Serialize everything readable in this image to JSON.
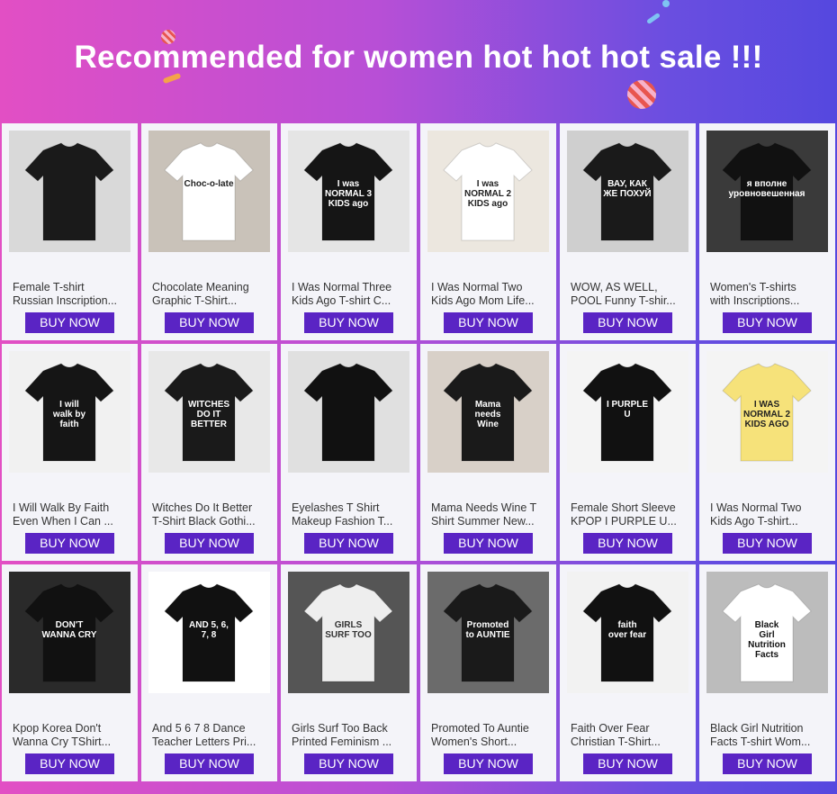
{
  "banner": {
    "title": "Recommended for women hot hot hot sale !!!"
  },
  "buy_label": "BUY NOW",
  "products": [
    {
      "l1": "Female T-shirt",
      "l2": "Russian Inscription...",
      "shirt": "#1a1a1a",
      "bg": "#d9d9d9",
      "text": "#ffffff",
      "print": "",
      "icon": "shirt-photo-icon"
    },
    {
      "l1": "Chocolate Meaning",
      "l2": "Graphic T-Shirt...",
      "shirt": "#ffffff",
      "bg": "#c9c2b9",
      "text": "#222222",
      "print": "Choc-o-late",
      "icon": "shirt-photo-icon"
    },
    {
      "l1": "I Was Normal Three",
      "l2": "Kids Ago T-shirt C...",
      "shirt": "#151515",
      "bg": "#e5e5e5",
      "text": "#ffffff",
      "print": "I was NORMAL 3 KIDS ago",
      "icon": "shirt-photo-icon"
    },
    {
      "l1": "I Was Normal Two",
      "l2": "Kids Ago Mom Life...",
      "shirt": "#ffffff",
      "bg": "#ece7df",
      "text": "#222222",
      "print": "I was NORMAL 2 KIDS ago",
      "icon": "shirt-photo-icon"
    },
    {
      "l1": "WOW, AS WELL,",
      "l2": "POOL Funny T-shir...",
      "shirt": "#1a1a1a",
      "bg": "#cfcfcf",
      "text": "#ffffff",
      "print": "ВАУ, КАК ЖЕ ПОХУЙ",
      "icon": "shirt-photo-icon"
    },
    {
      "l1": "Women's T-shirts",
      "l2": "with Inscriptions...",
      "shirt": "#111111",
      "bg": "#3a3a3a",
      "text": "#ffffff",
      "print": "я вполне уровновешенная",
      "icon": "shirt-photo-icon"
    },
    {
      "l1": "I Will Walk By Faith",
      "l2": "Even When I Can ...",
      "shirt": "#151515",
      "bg": "#f1f1f1",
      "text": "#ffffff",
      "print": "I will walk by faith",
      "icon": "shirt-photo-icon"
    },
    {
      "l1": "Witches Do It Better",
      "l2": "T-Shirt Black Gothi...",
      "shirt": "#1a1a1a",
      "bg": "#e8e8e8",
      "text": "#ffffff",
      "print": "WITCHES DO IT BETTER",
      "icon": "shirt-photo-icon"
    },
    {
      "l1": "Eyelashes T Shirt",
      "l2": "Makeup Fashion T...",
      "shirt": "#111111",
      "bg": "#e0e0e0",
      "text": "#ffffff",
      "print": "",
      "icon": "shirt-photo-icon"
    },
    {
      "l1": "Mama Needs Wine T",
      "l2": "Shirt Summer New...",
      "shirt": "#1a1a1a",
      "bg": "#d8d0c8",
      "text": "#ffffff",
      "print": "Mama needs Wine",
      "icon": "shirt-photo-icon"
    },
    {
      "l1": "Female Short Sleeve",
      "l2": "KPOP I PURPLE U...",
      "shirt": "#111111",
      "bg": "#f4f4f4",
      "text": "#ffffff",
      "print": "I PURPLE U",
      "icon": "shirt-photo-icon"
    },
    {
      "l1": "I Was Normal Two",
      "l2": "Kids Ago T-shirt...",
      "shirt": "#f6e27a",
      "bg": "#f4f4f4",
      "text": "#222222",
      "print": "I WAS NORMAL 2 KIDS AGO",
      "icon": "shirt-photo-icon"
    },
    {
      "l1": "Kpop Korea Don't",
      "l2": "Wanna Cry TShirt...",
      "shirt": "#111111",
      "bg": "#2a2a2a",
      "text": "#ffffff",
      "print": "DON'T WANNA CRY",
      "icon": "shirt-photo-icon"
    },
    {
      "l1": "And 5 6 7 8 Dance",
      "l2": "Teacher Letters Pri...",
      "shirt": "#111111",
      "bg": "#ffffff",
      "text": "#ffffff",
      "print": "AND 5, 6, 7, 8",
      "icon": "shirt-photo-icon"
    },
    {
      "l1": "Girls Surf Too Back",
      "l2": "Printed Feminism ...",
      "shirt": "#eeeeee",
      "bg": "#555555",
      "text": "#333333",
      "print": "GIRLS SURF TOO",
      "icon": "shirt-photo-icon"
    },
    {
      "l1": "Promoted To Auntie",
      "l2": "Women's Short...",
      "shirt": "#1a1a1a",
      "bg": "#6b6b6b",
      "text": "#ffffff",
      "print": "Promoted to AUNTIE",
      "icon": "shirt-photo-icon"
    },
    {
      "l1": "Faith Over Fear",
      "l2": "Christian T-Shirt...",
      "shirt": "#111111",
      "bg": "#f2f2f2",
      "text": "#ffffff",
      "print": "faith over fear",
      "icon": "shirt-photo-icon"
    },
    {
      "l1": "Black Girl Nutrition",
      "l2": "Facts T-shirt Wom...",
      "shirt": "#ffffff",
      "bg": "#bcbcbc",
      "text": "#111111",
      "print": "Black Girl Nutrition Facts",
      "icon": "shirt-photo-icon"
    }
  ]
}
